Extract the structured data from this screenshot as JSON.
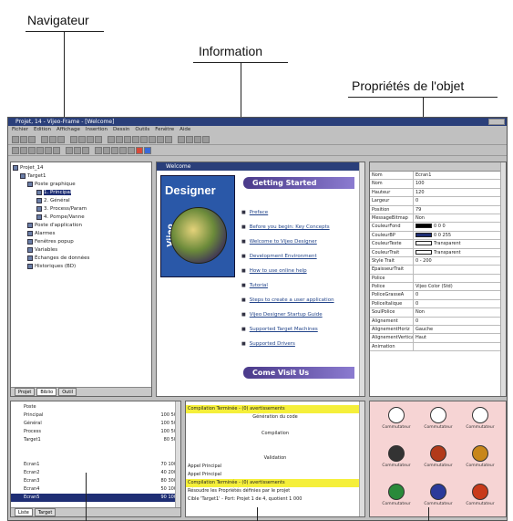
{
  "callouts": {
    "navigator": "Navigateur",
    "information": "Information",
    "properties": "Propriétés de l'objet"
  },
  "window": {
    "title": "Projet, 14 - Vijeo-Frame - [Welcome]",
    "menu": [
      "Fichier",
      "Edition",
      "Affichage",
      "Insertion",
      "Dessin",
      "Outils",
      "Fenêtre",
      "Aide"
    ]
  },
  "navigator": {
    "tree": [
      {
        "label": "Projet_14",
        "level": 0
      },
      {
        "label": "Target1",
        "level": 1
      },
      {
        "label": "Poste graphique",
        "level": 2
      },
      {
        "label": "1. Principal",
        "level": 3
      },
      {
        "label": "2. Général",
        "level": 3
      },
      {
        "label": "3. Process/Param",
        "level": 3
      },
      {
        "label": "4. Pompe/Vanne",
        "level": 3
      },
      {
        "label": "Poste d'application",
        "level": 2
      },
      {
        "label": "Alarmes",
        "level": 2
      },
      {
        "label": "Fenêtres popup",
        "level": 2
      },
      {
        "label": "Variables",
        "level": 2
      },
      {
        "label": "Échanges de données",
        "level": 2
      },
      {
        "label": "Historiques (BD)",
        "level": 2
      }
    ],
    "tabs": [
      "Projet",
      "Biblio",
      "Outil"
    ]
  },
  "information": {
    "header": "Welcome",
    "logo_text": "Designer",
    "logo_vertical": "Vijeo",
    "getting_started": "Getting Started",
    "links": [
      "Preface",
      "Before you begin: Key Concepts",
      "Welcome to Vijeo Designer",
      "Development Environment",
      "How to use online help",
      "Tutorial",
      "Steps to create a user application",
      "Vijeo Designer Startup Guide",
      "Supported Target Machines",
      "Supported Drivers"
    ],
    "come_visit": "Come Visit Us"
  },
  "properties": {
    "rows": [
      {
        "k": "Nom",
        "v": "Ecran1"
      },
      {
        "k": "Nom",
        "v": "100"
      },
      {
        "k": "Hauteur",
        "v": "120"
      },
      {
        "k": "Largeur",
        "v": "0"
      },
      {
        "k": "Position",
        "v": "79"
      },
      {
        "k": "MessageBitmap",
        "v": "Non"
      },
      {
        "k": "CouleurFond",
        "v": "0 0 0",
        "swatch": "#000000"
      },
      {
        "k": "CouleurBP",
        "v": "0 0 255",
        "swatch": "#1e2e74"
      },
      {
        "k": "CouleurTexte",
        "v": "Transparent",
        "swatch": "#ffffff"
      },
      {
        "k": "CouleurTrait",
        "v": "Transparent",
        "swatch": "#ffffff"
      },
      {
        "k": "Style Trait",
        "v": "0 - 200"
      },
      {
        "k": "EpaisseurTrait",
        "v": ""
      },
      {
        "k": "Police",
        "v": ""
      },
      {
        "k": "Police",
        "v": "Vijeo Color (Std)"
      },
      {
        "k": "PoliceGrasseA",
        "v": "0"
      },
      {
        "k": "PoliceItalique",
        "v": "0"
      },
      {
        "k": "SoulPolice",
        "v": "Non"
      },
      {
        "k": "Alignement",
        "v": "0"
      },
      {
        "k": "AlignementHoriz",
        "v": "Gauche"
      },
      {
        "k": "AlignementVertical",
        "v": "Haut"
      },
      {
        "k": "Animation",
        "v": ""
      }
    ]
  },
  "bottom_left": {
    "rows": [
      {
        "c1": "",
        "c2": "Poste",
        "c3": ""
      },
      {
        "c1": "",
        "c2": "Principal",
        "c3": "100 50"
      },
      {
        "c1": "",
        "c2": "Général",
        "c3": "100 50"
      },
      {
        "c1": "",
        "c2": "Process",
        "c3": "100 50"
      },
      {
        "c1": "",
        "c2": "Target1",
        "c3": "80 50"
      },
      {
        "c1": "",
        "c2": "",
        "c3": ""
      },
      {
        "c1": "",
        "c2": "",
        "c3": ""
      },
      {
        "c1": "",
        "c2": "Ecran1",
        "c3": "70 100"
      },
      {
        "c1": "",
        "c2": "Ecran2",
        "c3": "40 200"
      },
      {
        "c1": "",
        "c2": "Ecran3",
        "c3": "80 300"
      },
      {
        "c1": "",
        "c2": "Ecran4",
        "c3": "50 100"
      },
      {
        "c1": "",
        "c2": "Ecran5",
        "c3": "90 100",
        "sel": true
      },
      {
        "c1": "",
        "c2": "",
        "c3": ""
      }
    ],
    "tabs": [
      "Liste",
      "Target"
    ]
  },
  "bottom_middle": {
    "rows": [
      {
        "t": "Compilation Terminée - (0) avertissements",
        "cls": "yel"
      },
      {
        "t": "Génération du code",
        "cls": ""
      },
      {
        "t": "",
        "cls": ""
      },
      {
        "t": "Compilation",
        "cls": ""
      },
      {
        "t": "",
        "cls": ""
      },
      {
        "t": "",
        "cls": ""
      },
      {
        "t": "Validation",
        "cls": ""
      },
      {
        "t": "Appel Principal",
        "cls": "left"
      },
      {
        "t": "Appel Principal",
        "cls": "left"
      },
      {
        "t": "Compilation Terminée - (0) avertissements",
        "cls": "yel"
      },
      {
        "t": "Résoudre les Propriétés définies par le projet",
        "cls": "left"
      },
      {
        "t": "Cible 'Target1' - Port: Projet 1 de 4, quotient 1 000",
        "cls": "left"
      }
    ]
  },
  "palette": {
    "items": [
      {
        "label": "Commutateur",
        "color": "#ffffff",
        "border": "#333"
      },
      {
        "label": "Commutateur",
        "color": "#ffffff",
        "border": "#333"
      },
      {
        "label": "Commutateur",
        "color": "#ffffff",
        "border": "#333"
      },
      {
        "label": "Commutateur",
        "color": "#333333",
        "border": "#333"
      },
      {
        "label": "Commutateur",
        "color": "#b23a1a",
        "border": "#333"
      },
      {
        "label": "Commutateur",
        "color": "#c8861a",
        "border": "#333"
      },
      {
        "label": "Commutateur",
        "color": "#2a8a3a",
        "border": "#333"
      },
      {
        "label": "Commutateur",
        "color": "#2a3a9a",
        "border": "#333"
      },
      {
        "label": "Commutateur",
        "color": "#c83a1a",
        "border": "#333"
      }
    ]
  }
}
